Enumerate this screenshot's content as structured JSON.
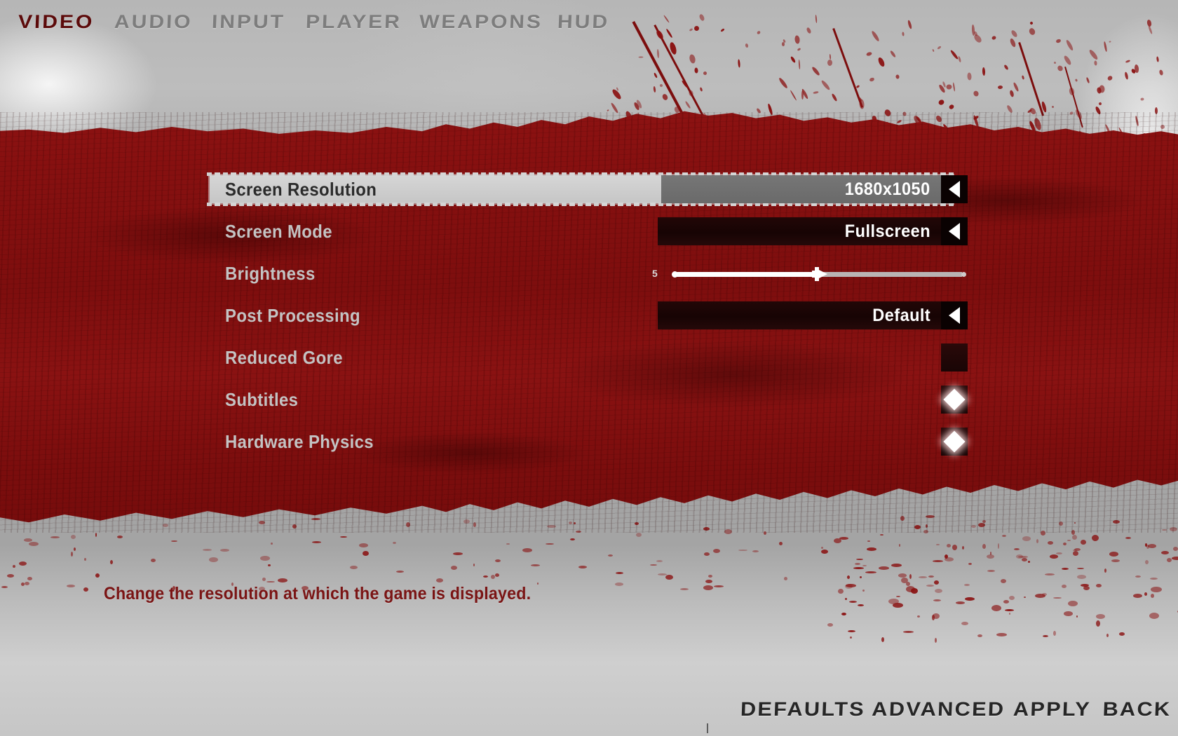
{
  "nav": {
    "tabs": [
      {
        "label": "VIDEO",
        "active": true
      },
      {
        "label": "AUDIO",
        "active": false
      },
      {
        "label": "INPUT",
        "active": false
      },
      {
        "label": "PLAYER",
        "active": false
      },
      {
        "label": "WEAPONS",
        "active": false
      },
      {
        "label": "HUD",
        "active": false
      }
    ]
  },
  "settings": {
    "rows": [
      {
        "label": "Screen Resolution",
        "type": "selector",
        "value": "1680x1050",
        "selected": true
      },
      {
        "label": "Screen Mode",
        "type": "selector",
        "value": "Fullscreen",
        "selected": false
      },
      {
        "label": "Brightness",
        "type": "slider",
        "value": "5",
        "percent": 50,
        "selected": false
      },
      {
        "label": "Post Processing",
        "type": "selector",
        "value": "Default",
        "selected": false
      },
      {
        "label": "Reduced Gore",
        "type": "checkbox",
        "checked": false,
        "selected": false
      },
      {
        "label": "Subtitles",
        "type": "checkbox",
        "checked": true,
        "selected": false
      },
      {
        "label": "Hardware Physics",
        "type": "checkbox",
        "checked": true,
        "selected": false
      }
    ],
    "arrow_icon": "caret-left-icon",
    "check_icon": "diamond-check-icon"
  },
  "description": {
    "text": "Change the resolution at which the game is displayed."
  },
  "footer": {
    "buttons": [
      {
        "label": "DEFAULTS"
      },
      {
        "label": "ADVANCED"
      },
      {
        "label": "APPLY"
      },
      {
        "label": "BACK"
      }
    ]
  },
  "colors": {
    "blood": "#8a1111",
    "blood_dark": "#760c0c",
    "active_tab": "#5c0a0a",
    "inactive_tab": "#7d7d7d",
    "label": "#c3c3c3",
    "selected_label": "#2b2b2b",
    "highlight_bar": "#cfcfcf",
    "value_bar_selected": "#6a6a6a",
    "value_bar": "#170404",
    "value_text": "#ffffff",
    "description_text": "#7a1414",
    "footer_text": "#262626"
  }
}
